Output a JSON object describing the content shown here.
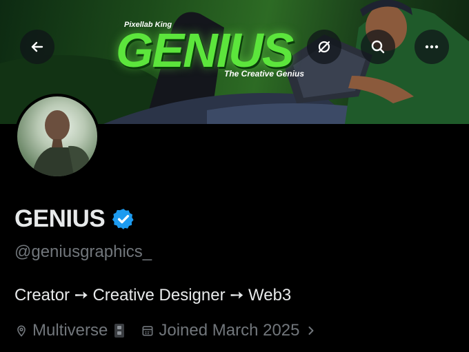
{
  "banner": {
    "kicker": "Pixellab King",
    "title": "GENIUS",
    "subtitle": "The Creative Genius"
  },
  "header": {
    "back_icon": "arrow-left-icon",
    "grok_icon": "grok-icon",
    "search_icon": "search-icon",
    "more_icon": "more-horizontal-icon"
  },
  "profile": {
    "name": "GENIUS",
    "verified_color": "#1d9bf0",
    "handle": "@geniusgraphics_",
    "bio": "Creator ➙ Creative Designer ➙ Web3",
    "location": "Multiverse",
    "joined": "Joined March 2025"
  },
  "colors": {
    "background": "#000000",
    "primary_text": "#e7e9ea",
    "secondary_text": "#71767b",
    "banner_accent": "#5ce53c"
  }
}
